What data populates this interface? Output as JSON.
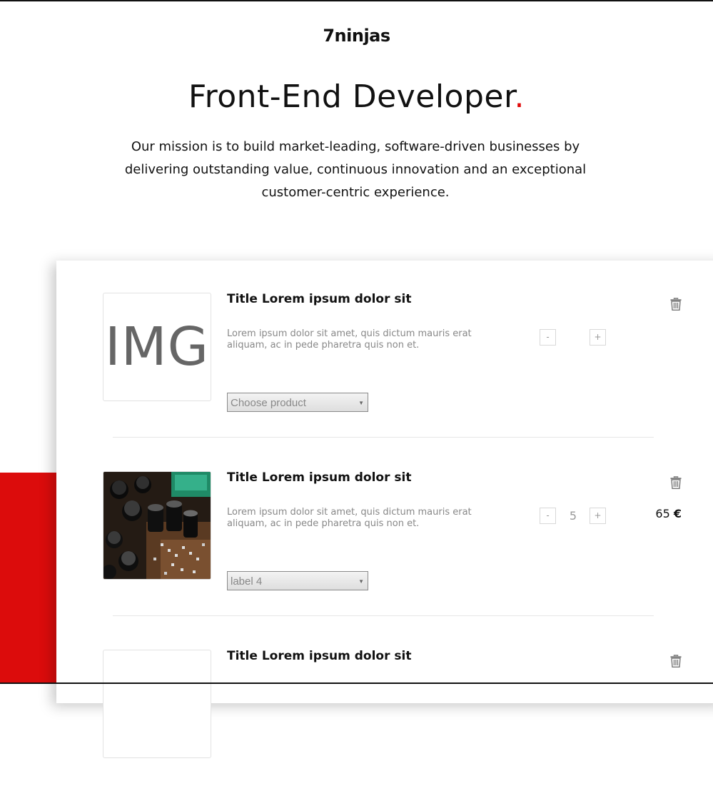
{
  "header": {
    "logo": "7ninjas",
    "title": "Front-End Developer",
    "title_dot": ".",
    "mission": "Our mission is to build market-leading, software-driven businesses by delivering outstanding value, continuous innovation and an exceptional customer-centric experience."
  },
  "colors": {
    "accent": "#dc0c0c",
    "text": "#111111",
    "muted": "#888888"
  },
  "cart": {
    "items": [
      {
        "image_text": "IMG",
        "title": "Title Lorem ipsum dolor sit",
        "description": "Lorem ipsum dolor sit amet, quis dictum mauris erat aliquam, ac in pede pharetra quis non et.",
        "select_value": "Choose product",
        "minus_label": "-",
        "plus_label": "+",
        "quantity": "",
        "price": "",
        "currency": "",
        "delete_icon": "trash-icon"
      },
      {
        "image_text": "",
        "title": "Title Lorem ipsum dolor sit",
        "description": "Lorem ipsum dolor sit amet, quis dictum mauris erat aliquam, ac in pede pharetra quis non et.",
        "select_value": "label 4",
        "minus_label": "-",
        "plus_label": "+",
        "quantity": "5",
        "price": "65",
        "currency": "€",
        "delete_icon": "trash-icon"
      },
      {
        "image_text": "",
        "title": "Title Lorem ipsum dolor sit",
        "delete_icon": "trash-icon"
      }
    ]
  }
}
